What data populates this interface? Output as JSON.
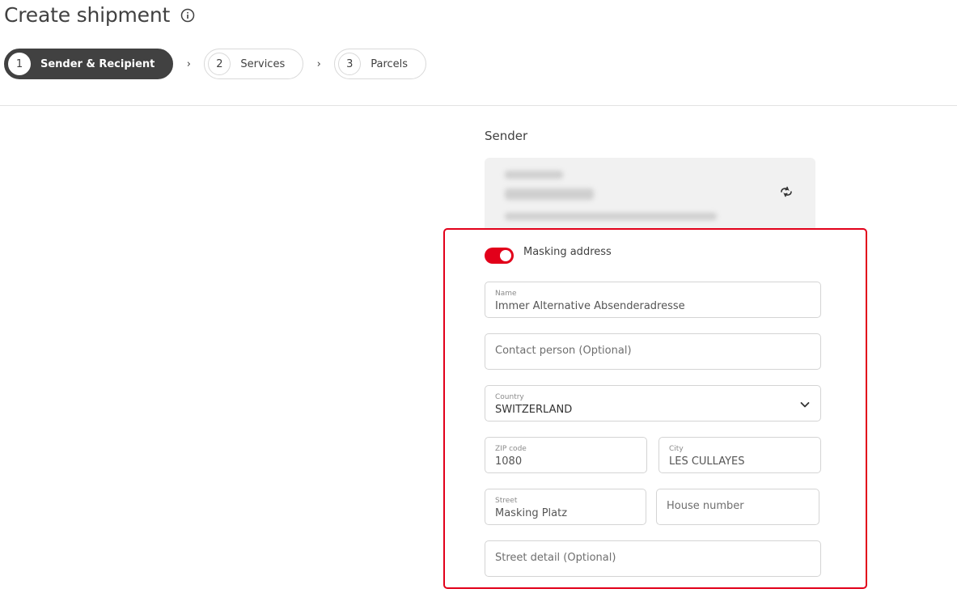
{
  "page": {
    "title": "Create shipment"
  },
  "stepper": {
    "steps": [
      {
        "number": "1",
        "label": "Sender & Recipient"
      },
      {
        "number": "2",
        "label": "Services"
      },
      {
        "number": "3",
        "label": "Parcels"
      }
    ],
    "separator": "›"
  },
  "sender": {
    "title": "Sender",
    "masking_toggle": {
      "label": "Masking address",
      "on": true
    },
    "fields": {
      "name": {
        "label": "Name",
        "value": "Immer Alternative Absenderadresse"
      },
      "contact_person": {
        "placeholder": "Contact person (Optional)"
      },
      "country": {
        "label": "Country",
        "value": "SWITZERLAND"
      },
      "zip": {
        "label": "ZIP code",
        "value": "1080"
      },
      "city": {
        "label": "City",
        "value": "LES CULLAYES"
      },
      "street": {
        "label": "Street",
        "value": "Masking Platz"
      },
      "house_number": {
        "placeholder": "House number"
      },
      "street_detail": {
        "placeholder": "Street detail (Optional)"
      }
    }
  },
  "icons": {
    "info": "info-icon",
    "swap": "swap-icon",
    "dropdown": "chevron-down-icon"
  },
  "colors": {
    "accent": "#e2001a",
    "active_step": "#414141"
  }
}
